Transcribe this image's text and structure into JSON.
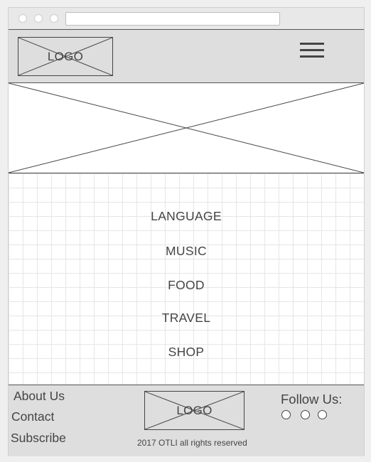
{
  "header": {
    "logo_label": "LOGO",
    "menu_icon": "hamburger-menu-icon"
  },
  "hero": {
    "placeholder": "image-placeholder"
  },
  "nav": {
    "items": [
      {
        "label": "LANGUAGE"
      },
      {
        "label": "MUSIC"
      },
      {
        "label": "FOOD"
      },
      {
        "label": "TRAVEL"
      },
      {
        "label": "SHOP"
      }
    ]
  },
  "footer": {
    "links": [
      {
        "label": "About Us"
      },
      {
        "label": "Contact"
      },
      {
        "label": "Subscribe"
      }
    ],
    "logo_label": "LOGO",
    "copyright": "2017 OTLI all rights reserved",
    "follow_label": "Follow Us:",
    "social_icons": [
      "social-icon-1",
      "social-icon-2",
      "social-icon-3"
    ]
  },
  "colors": {
    "line": "#444444",
    "panel": "#dedede",
    "background": "#efefef"
  }
}
